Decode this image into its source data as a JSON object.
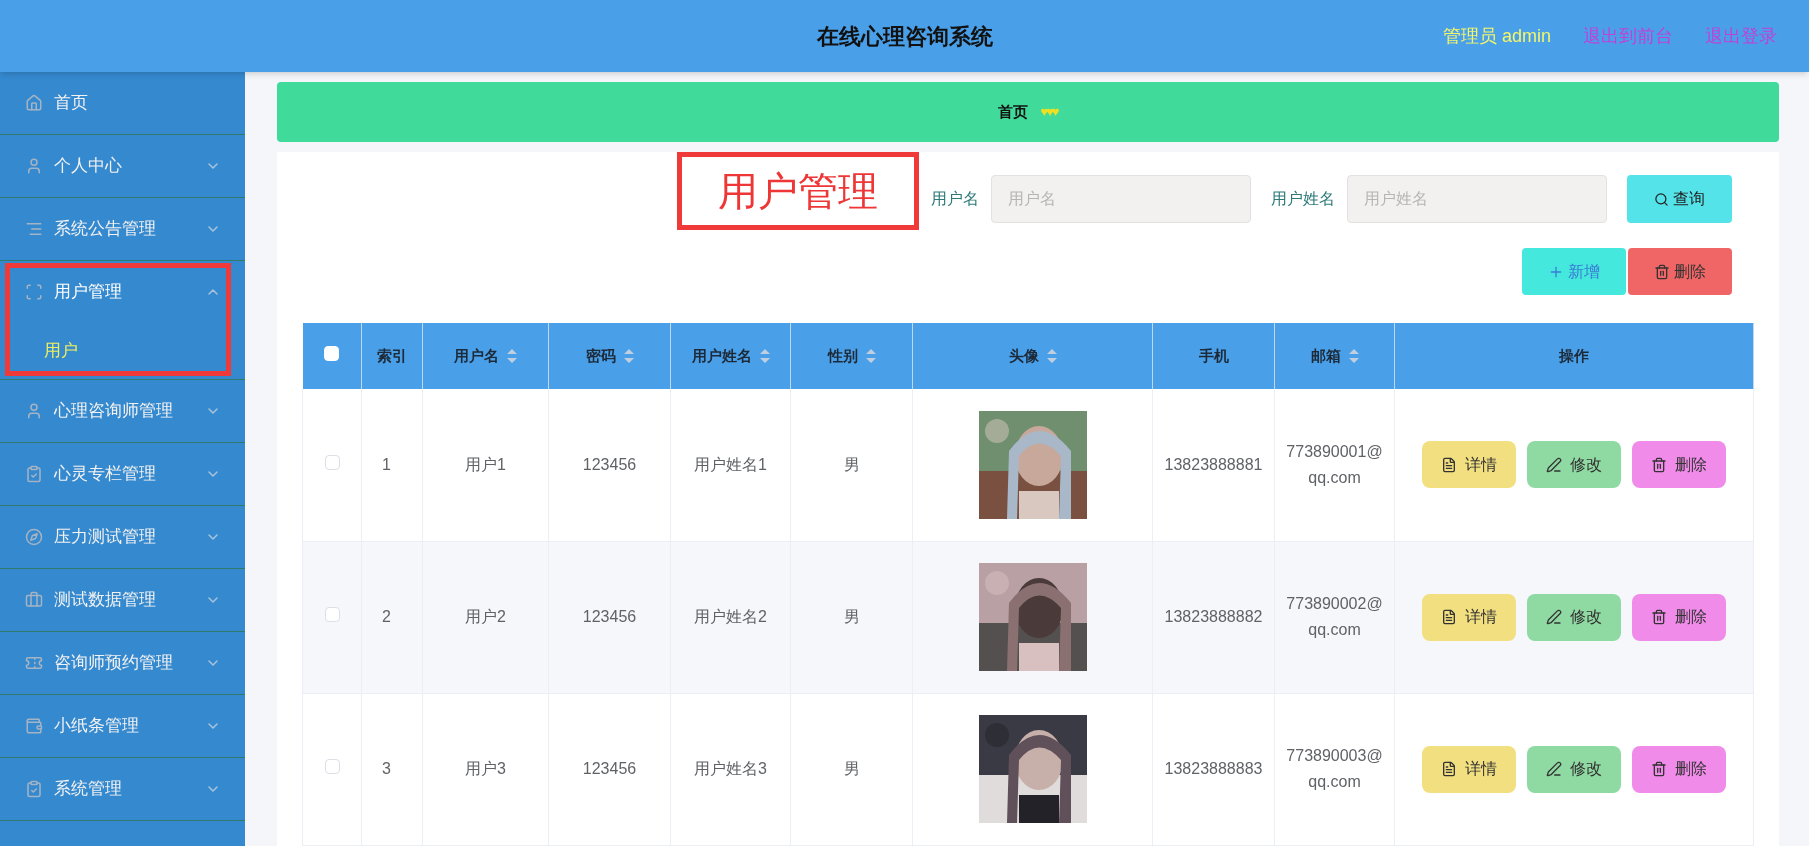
{
  "header": {
    "title": "在线心理咨询系统",
    "role": "管理员 admin",
    "links": [
      "退出到前台",
      "退出登录"
    ]
  },
  "sidebar": {
    "items": [
      {
        "label": "首页"
      },
      {
        "label": "个人中心",
        "expanded": false
      },
      {
        "label": "系统公告管理",
        "expanded": false
      },
      {
        "label": "用户管理",
        "expanded": true,
        "highlighted": true,
        "children": [
          {
            "label": "用户",
            "selected": true
          }
        ]
      },
      {
        "label": "心理咨询师管理",
        "expanded": false
      },
      {
        "label": "心灵专栏管理",
        "expanded": false
      },
      {
        "label": "压力测试管理",
        "expanded": false
      },
      {
        "label": "测试数据管理",
        "expanded": false
      },
      {
        "label": "咨询师预约管理",
        "expanded": false
      },
      {
        "label": "小纸条管理",
        "expanded": false
      },
      {
        "label": "系统管理",
        "expanded": false
      }
    ]
  },
  "breadcrumb": {
    "home": "首页",
    "separator": "♥♥♥"
  },
  "annotation": {
    "text": "用户管理"
  },
  "search": {
    "fields": [
      {
        "label": "用户名",
        "placeholder": "用户名"
      },
      {
        "label": "用户姓名",
        "placeholder": "用户姓名"
      }
    ],
    "button": "查询"
  },
  "actions": [
    {
      "label": "新增",
      "kind": "add"
    },
    {
      "label": "删除",
      "kind": "delete"
    }
  ],
  "table": {
    "select_all": {
      "checked": false
    },
    "columns": [
      {
        "label": "索引",
        "sortable": false
      },
      {
        "label": "用户名",
        "sortable": true
      },
      {
        "label": "密码",
        "sortable": true
      },
      {
        "label": "用户姓名",
        "sortable": true
      },
      {
        "label": "性别",
        "sortable": true
      },
      {
        "label": "头像",
        "sortable": true
      },
      {
        "label": "手机",
        "sortable": false
      },
      {
        "label": "邮箱",
        "sortable": true
      },
      {
        "label": "操作",
        "sortable": false
      }
    ],
    "rows": [
      {
        "checked": false,
        "cells": [
          "1",
          "用户1",
          "123456",
          "用户姓名1",
          "男",
          {
            "kind": "picture"
          },
          "13823888881",
          "773890001@qq.com"
        ],
        "buttons": [
          {
            "label": "详情",
            "kind": "detail"
          },
          {
            "label": "修改",
            "kind": "edit"
          },
          {
            "label": "删除",
            "kind": "delete"
          }
        ]
      },
      {
        "checked": false,
        "cells": [
          "2",
          "用户2",
          "123456",
          "用户姓名2",
          "男",
          {
            "kind": "picture"
          },
          "13823888882",
          "773890002@qq.com"
        ],
        "buttons": [
          {
            "label": "详情",
            "kind": "detail"
          },
          {
            "label": "修改",
            "kind": "edit"
          },
          {
            "label": "删除",
            "kind": "delete"
          }
        ]
      },
      {
        "checked": false,
        "cells": [
          "3",
          "用户3",
          "123456",
          "用户姓名3",
          "男",
          {
            "kind": "picture"
          },
          "13823888883",
          "773890003@qq.com"
        ],
        "buttons": [
          {
            "label": "详情",
            "kind": "detail"
          },
          {
            "label": "修改",
            "kind": "edit"
          },
          {
            "label": "删除",
            "kind": "delete"
          }
        ]
      }
    ]
  }
}
